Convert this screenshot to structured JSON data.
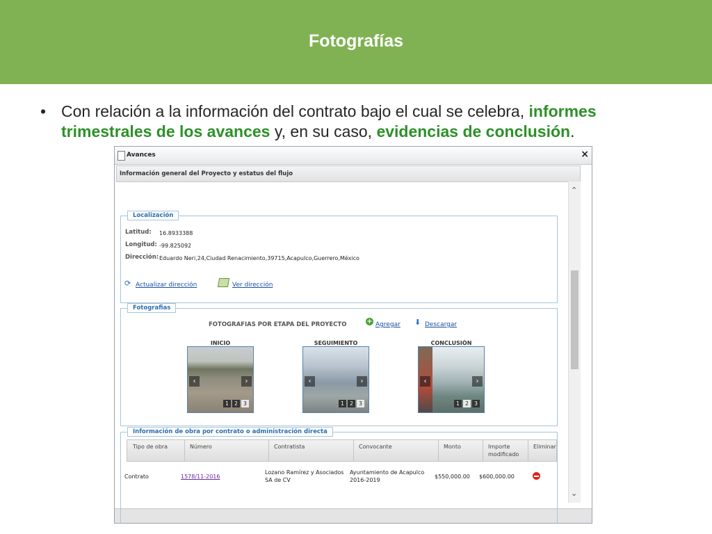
{
  "slide": {
    "title": "Fotografías",
    "bullet": {
      "text_1": "Con relación a la información del contrato bajo el cual se celebra, ",
      "highlight_1": "informes trimestrales de los avances",
      "text_2": " y, en su caso, ",
      "highlight_2": "evidencias de conclusión",
      "text_3": "."
    }
  },
  "window": {
    "title": "Avances",
    "close_glyph": "×",
    "subheader": "Información general del Proyecto y estatus del flujo"
  },
  "localizacion": {
    "legend": "Localización",
    "lat_label": "Latitud:",
    "lat_value": "16.8933388",
    "lon_label": "Longitud:",
    "lon_value": "-99.825092",
    "dir_label": "Dirección:",
    "dir_value": "Eduardo Neri,24,Ciudad Renacimiento,39715,Acapulco,Guerrero,México",
    "update_link": "Actualizar dirección",
    "view_link": "Ver dirección"
  },
  "fotografias": {
    "legend": "Fotografias",
    "heading": "FOTOGRAFIAS POR ETAPA DEL PROYECTO",
    "add_link": "Agregar",
    "download_link": "Descargar",
    "stages": [
      {
        "label": "INICIO",
        "active_page": 3
      },
      {
        "label": "SEGUIMIENTO",
        "active_page": 3
      },
      {
        "label": "CONCLUSIÓN",
        "active_page": 2
      }
    ],
    "pages": [
      "1",
      "2",
      "3"
    ],
    "prev_glyph": "‹",
    "next_glyph": "›"
  },
  "obra": {
    "legend": "Información de obra por contrato o administración directa",
    "columns": [
      "Tipo de obra",
      "Número",
      "Contratista",
      "Convocante",
      "Monto",
      "Importe modificado",
      "Eliminar"
    ],
    "row": {
      "tipo": "Contrato",
      "numero": "1578/11-2016",
      "contratista": "Lozano Ramírez y Asociados SA de CV",
      "convocante": "Ayuntamiento de Acapulco 2016-2019",
      "monto": "$550,000.00",
      "importe": "$600,000.00"
    }
  },
  "icons": [
    "doc-icon",
    "close-icon",
    "refresh-icon",
    "map-icon",
    "add-icon",
    "download-icon",
    "delete-icon",
    "scroll-up-icon",
    "scroll-down-icon"
  ],
  "colors": {
    "header_green": "#80b253",
    "highlight_green": "#2d9128",
    "link_blue": "#1a4fa0",
    "legend_blue": "#2c6faf"
  }
}
